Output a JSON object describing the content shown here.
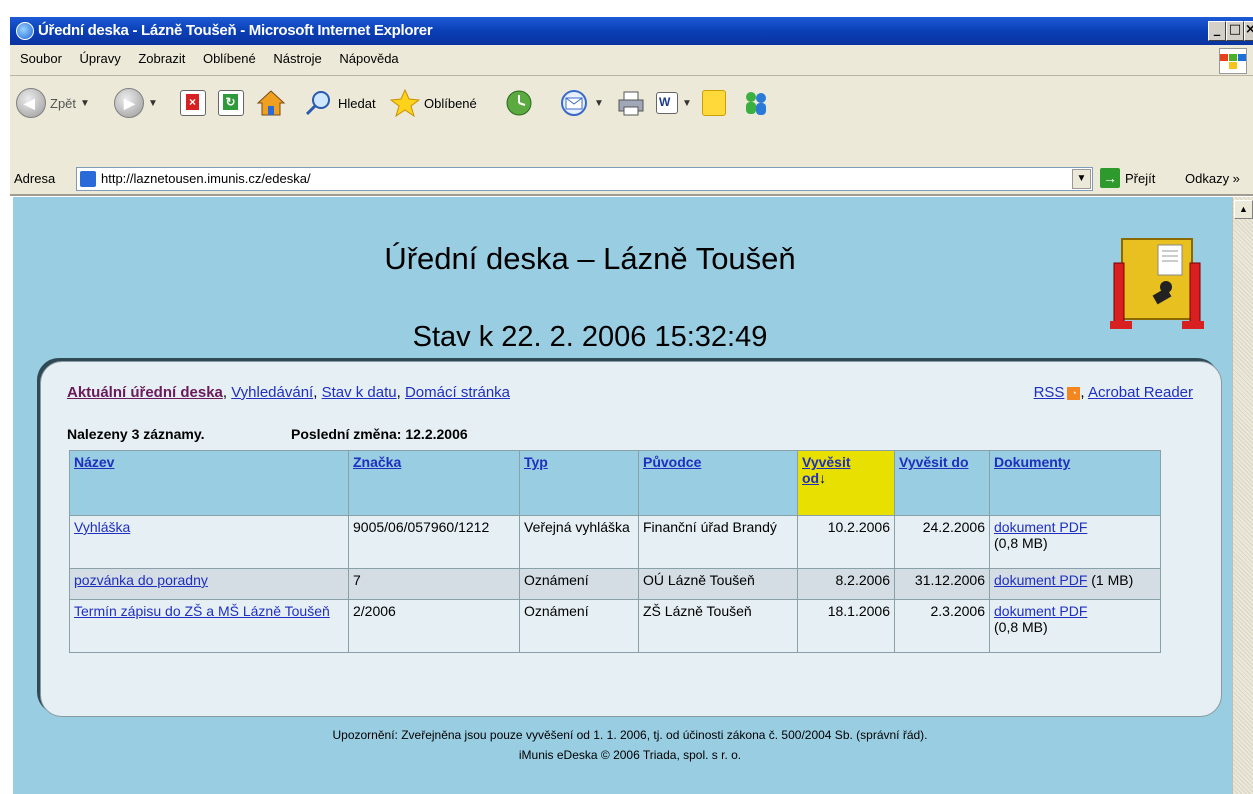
{
  "window": {
    "title": "Úřední deska - Lázně Toušeň - Microsoft Internet Explorer",
    "min_label": "_",
    "max_label": "□",
    "close_label": "×"
  },
  "menu": [
    "Soubor",
    "Úpravy",
    "Zobrazit",
    "Oblíbené",
    "Nástroje",
    "Nápověda"
  ],
  "toolbar": {
    "back_label": "Zpět",
    "search_label": "Hledat",
    "favorites_label": "Oblíbené"
  },
  "address": {
    "label": "Adresa",
    "url": "http://laznetousen.imunis.cz/edeska/",
    "go_label": "Přejít",
    "links_label": "Odkazy »"
  },
  "page": {
    "title": "Úřední deska – Lázně Toušeň",
    "status": "Stav k 22. 2. 2006 15:32:49",
    "nav": {
      "current": "Aktuální úřední deska",
      "search": "Vyhledávání",
      "by_date": "Stav k datu",
      "home": "Domácí stránka"
    },
    "rss": "RSS",
    "acrobat": "Acrobat Reader",
    "found": "Nalezeny 3 záznamy.",
    "last_change": "Poslední změna: 12.2.2006",
    "table": {
      "headers": {
        "name": "Název",
        "mark": "Značka",
        "type": "Typ",
        "origin": "Původce",
        "post_from_1": "Vyvěsit",
        "post_from_2": "od",
        "post_to": "Vyvěsit do",
        "docs": "Dokumenty"
      },
      "rows": [
        {
          "name": "Vyhláška",
          "mark": "9005/06/057960/1212",
          "type": "Veřejná vyhláška",
          "origin": "Finanční úřad Brandý",
          "from": "10.2.2006",
          "to": "24.2.2006",
          "doc": "dokument PDF",
          "size": "(0,8 MB)"
        },
        {
          "name": "pozvánka do poradny",
          "mark": "7",
          "type": "Oznámení",
          "origin": "OÚ Lázně Toušeň",
          "from": "8.2.2006",
          "to": "31.12.2006",
          "doc": "dokument PDF",
          "size": "(1 MB)"
        },
        {
          "name": "Termín zápisu do ZŠ a MŠ Lázně Toušeň",
          "mark": "2/2006",
          "type": "Oznámení",
          "origin": "ZŠ Lázně Toušeň",
          "from": "18.1.2006",
          "to": "2.3.2006",
          "doc": "dokument PDF",
          "size": "(0,8 MB)"
        }
      ]
    },
    "footer_line1": "Upozornění: Zveřejněna jsou pouze vyvěšení od 1. 1. 2006, tj. od účinosti zákona č. 500/2004 Sb. (správní řád).",
    "footer_line2": "iMunis eDeska © 2006 Triada, spol. s r. o."
  },
  "colors": {
    "page_bg": "#99cde2",
    "panel_bg": "#e6eff4",
    "link": "#1f2fbf",
    "sorted_header": "#e8e000",
    "titlebar": "#0a3fb5"
  },
  "icons": [
    "ie-icon",
    "windows-logo-icon",
    "back-icon",
    "forward-icon",
    "stop-icon",
    "refresh-icon",
    "home-icon",
    "search-icon",
    "favorites-star-icon",
    "history-icon",
    "mail-icon",
    "print-icon",
    "edit-word-icon",
    "notes-icon",
    "messenger-icon",
    "page-icon",
    "go-arrow-icon",
    "rss-icon",
    "notice-board-logo-icon",
    "sort-down-icon"
  ]
}
